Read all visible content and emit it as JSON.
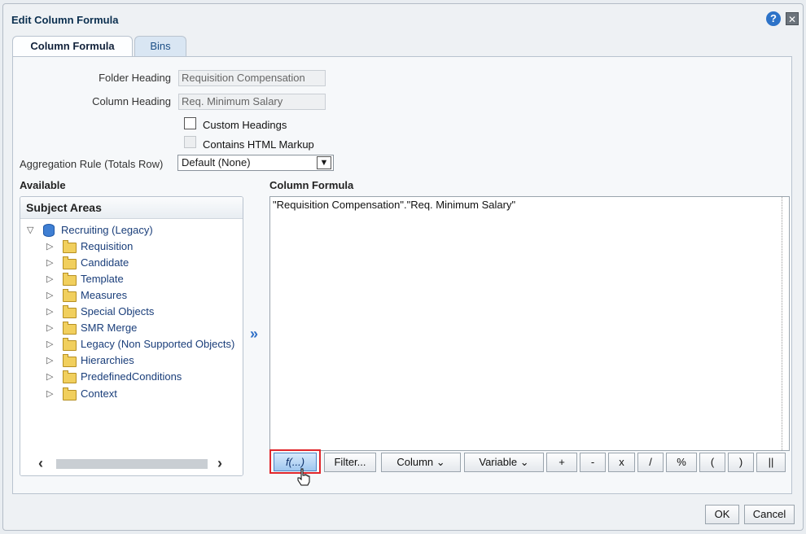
{
  "dialog": {
    "title": "Edit Column Formula"
  },
  "tabs": [
    {
      "label": "Column Formula"
    },
    {
      "label": "Bins"
    }
  ],
  "fields": {
    "folder_heading_label": "Folder Heading",
    "folder_heading_value": "Requisition Compensation",
    "column_heading_label": "Column Heading",
    "column_heading_value": "Req. Minimum Salary",
    "custom_headings_label": "Custom Headings",
    "contains_html_label": "Contains HTML Markup",
    "aggregation_label": "Aggregation Rule (Totals Row)",
    "aggregation_value": "Default (None)"
  },
  "available": {
    "heading": "Available",
    "panel_title": "Subject Areas",
    "root": "Recruiting (Legacy)",
    "items": [
      "Requisition",
      "Candidate",
      "Template",
      "Measures",
      "Special Objects",
      "SMR Merge",
      "Legacy (Non Supported Objects)",
      "Hierarchies",
      "PredefinedConditions",
      "Context"
    ]
  },
  "formula": {
    "heading": "Column Formula",
    "text": "\"Requisition Compensation\".\"Req. Minimum Salary\""
  },
  "toolbar": {
    "fx": "f(...)",
    "filter": "Filter...",
    "column": "Column",
    "variable": "Variable",
    "plus": "+",
    "minus": "-",
    "times": "x",
    "divide": "/",
    "percent": "%",
    "lparen": "(",
    "rparen": ")",
    "concat": "||"
  },
  "footer": {
    "ok": "OK",
    "cancel": "Cancel"
  }
}
